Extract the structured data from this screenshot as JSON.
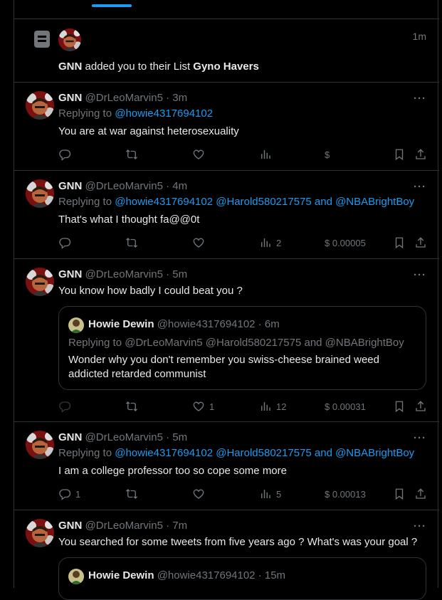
{
  "colors": {
    "background": "#000000",
    "border": "#2f3336",
    "text": "#e7e9ea",
    "muted": "#71767b",
    "link": "#1d9bf0"
  },
  "notification": {
    "time": "1m",
    "actor": "GNN",
    "text": " added you to their List ",
    "list_name": "Gyno Havers",
    "icon": "list-icon"
  },
  "tweets": [
    {
      "name": "GNN",
      "handle": "@DrLeoMarvin5",
      "time": "3m",
      "replying_label": "Replying to ",
      "replying_to": "@howie4317694102",
      "text": "You are at war against heterosexuality",
      "replies": "",
      "views": "",
      "tips": "$"
    },
    {
      "name": "GNN",
      "handle": "@DrLeoMarvin5",
      "time": "4m",
      "replying_label": "Replying to ",
      "replying_to": "@howie4317694102 @Harold580217575 and @NBABrightBoy",
      "text": "That's what I thought fa@@0t",
      "views": "2",
      "tips": "$ 0.00005"
    },
    {
      "name": "GNN",
      "handle": "@DrLeoMarvin5",
      "time": "5m",
      "text": "You know how badly I could beat you ?",
      "quote": {
        "name": "Howie Dewin",
        "handle": "@howie4317694102",
        "time": "6m",
        "replying": "Replying to @DrLeoMarvin5 @Harold580217575 and @NBABrightBoy",
        "text_line1": "Wonder why you don't remember you swiss-cheese brained weed",
        "text_line2": "addicted retarded communist"
      },
      "likes": "1",
      "views": "12",
      "tips": "$ 0.00031"
    },
    {
      "name": "GNN",
      "handle": "@DrLeoMarvin5",
      "time": "5m",
      "replying_label": "Replying to ",
      "replying_to": "@howie4317694102 @Harold580217575 and @NBABrightBoy",
      "text": "I am a college professor too so cope some more",
      "replies": "1",
      "views": "5",
      "tips": "$ 0.00013"
    },
    {
      "name": "GNN",
      "handle": "@DrLeoMarvin5",
      "time": "7m",
      "text": "You searched for some tweets from five years ago ? What's was your goal ?",
      "quote": {
        "name": "Howie Dewin",
        "handle": "@howie4317694102",
        "time": "15m"
      }
    }
  ],
  "sep": " · ",
  "more_glyph": "···"
}
